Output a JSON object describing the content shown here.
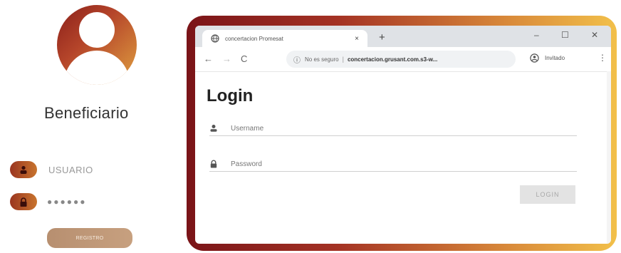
{
  "left_panel": {
    "role_label": "Beneficiario",
    "username_placeholder": "USUARIO",
    "password_mask": "●●●●●●",
    "register_label": "REGISTRO"
  },
  "browser": {
    "tab_title": "concertacion Promesat",
    "tab_close": "×",
    "new_tab": "+",
    "window_controls": {
      "minimize": "–",
      "maximize": "☐",
      "close": "✕"
    },
    "nav": {
      "back": "←",
      "forward": "→",
      "reload": "C"
    },
    "address": {
      "security_label": "No es seguro",
      "separator": "|",
      "url": "concertacion.grusant.com.s3-w..."
    },
    "profile_label": "Invitado",
    "menu": "⋮"
  },
  "login_form": {
    "title": "Login",
    "username_placeholder": "Username",
    "password_placeholder": "Password",
    "login_button": "LOGIN"
  },
  "colors": {
    "brand_dark": "#8a1f1a",
    "brand_gold": "#e0a040",
    "register_button": "#b78f70"
  }
}
